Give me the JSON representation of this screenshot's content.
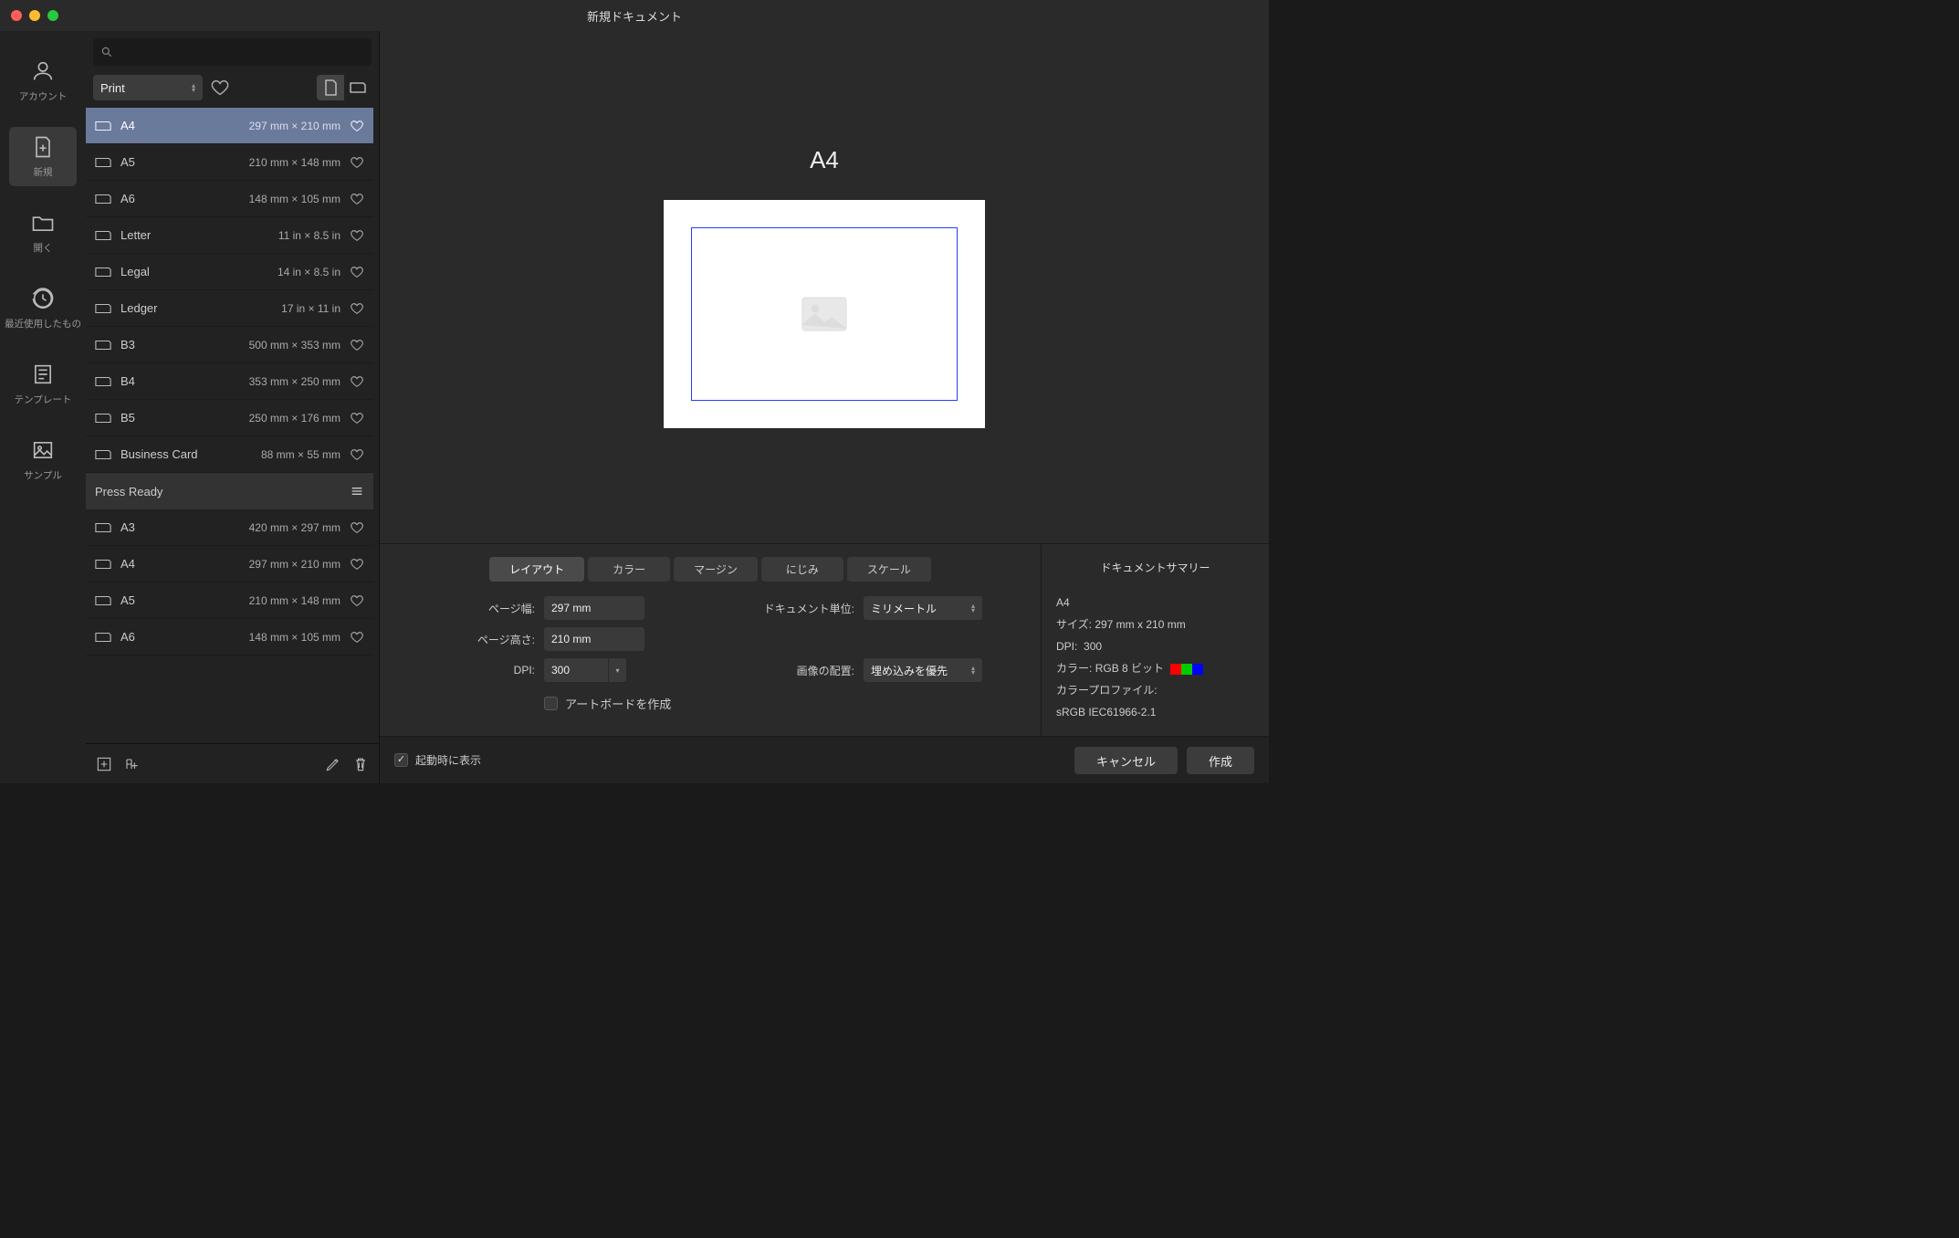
{
  "window": {
    "title": "新規ドキュメント"
  },
  "rail": {
    "account": "アカウント",
    "new": "新規",
    "open": "開く",
    "recent": "最近使用したもの",
    "template": "テンプレート",
    "sample": "サンプル"
  },
  "presets": {
    "category": "Print",
    "section_press": "Press Ready",
    "items": [
      {
        "name": "A4",
        "dims": "297 mm × 210 mm",
        "selected": true
      },
      {
        "name": "A5",
        "dims": "210 mm × 148 mm"
      },
      {
        "name": "A6",
        "dims": "148 mm × 105 mm"
      },
      {
        "name": "Letter",
        "dims": "11 in × 8.5 in"
      },
      {
        "name": "Legal",
        "dims": "14 in × 8.5 in"
      },
      {
        "name": "Ledger",
        "dims": "17 in × 11 in"
      },
      {
        "name": "B3",
        "dims": "500 mm × 353 mm"
      },
      {
        "name": "B4",
        "dims": "353 mm × 250 mm"
      },
      {
        "name": "B5",
        "dims": "250 mm × 176 mm"
      },
      {
        "name": "Business Card",
        "dims": "88 mm × 55 mm"
      }
    ],
    "press_items": [
      {
        "name": "A3",
        "dims": "420 mm × 297 mm"
      },
      {
        "name": "A4",
        "dims": "297 mm × 210 mm"
      },
      {
        "name": "A5",
        "dims": "210 mm × 148 mm"
      },
      {
        "name": "A6",
        "dims": "148 mm × 105 mm"
      }
    ]
  },
  "preview": {
    "title": "A4"
  },
  "tabs": {
    "layout": "レイアウト",
    "color": "カラー",
    "margin": "マージン",
    "bleed": "にじみ",
    "scale": "スケール"
  },
  "layout": {
    "page_width_label": "ページ幅:",
    "page_width_value": "297 mm",
    "page_height_label": "ページ高さ:",
    "page_height_value": "210 mm",
    "dpi_label": "DPI:",
    "dpi_value": "300",
    "doc_units_label": "ドキュメント単位:",
    "doc_units_value": "ミリメートル",
    "image_placement_label": "画像の配置:",
    "image_placement_value": "埋め込みを優先",
    "artboard_label": "アートボードを作成"
  },
  "summary": {
    "heading": "ドキュメントサマリー",
    "name": "A4",
    "size_label": "サイズ:",
    "size_value": "297 mm x 210 mm",
    "dpi_label": "DPI:",
    "dpi_value": "300",
    "color_label": "カラー:",
    "color_value": "RGB 8 ビット",
    "profile_label": "カラープロファイル:",
    "profile_value": "sRGB IEC61966-2.1"
  },
  "footer": {
    "show_on_startup": "起動時に表示",
    "cancel": "キャンセル",
    "create": "作成"
  }
}
